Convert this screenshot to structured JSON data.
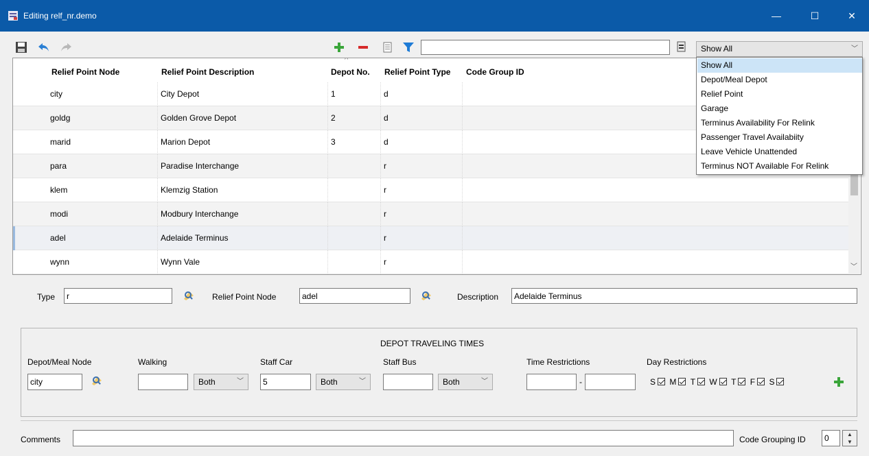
{
  "window": {
    "title": "Editing relf_nr.demo",
    "minimize": "—",
    "maximize": "☐",
    "close": "✕",
    "title_bar_color": "#0b5aa8"
  },
  "toolbar": {
    "search_value": "",
    "filter_selected": "Show All"
  },
  "filter_options": [
    "Show All",
    "Depot/Meal Depot",
    "Relief Point",
    "Garage",
    "Terminus Availability For Relink",
    "Passenger Travel Availabiity",
    "Leave Vehicle Unattended",
    "Terminus NOT Available For Relink"
  ],
  "grid": {
    "columns": [
      "Relief Point Node",
      "Relief Point Description",
      "Depot No.",
      "Relief Point Type",
      "Code Group ID"
    ],
    "rows": [
      [
        "city",
        "City Depot",
        "1",
        "d",
        ""
      ],
      [
        "goldg",
        "Golden Grove Depot",
        "2",
        "d",
        ""
      ],
      [
        "marid",
        "Marion Depot",
        "3",
        "d",
        ""
      ],
      [
        "para",
        "Paradise Interchange",
        "",
        "r",
        ""
      ],
      [
        "klem",
        "Klemzig Station",
        "",
        "r",
        ""
      ],
      [
        "modi",
        "Modbury Interchange",
        "",
        "r",
        ""
      ],
      [
        "adel",
        "Adelaide Terminus",
        "",
        "r",
        ""
      ],
      [
        "wynn",
        "Wynn Vale",
        "",
        "r",
        ""
      ]
    ]
  },
  "form": {
    "type_label": "Type",
    "type_value": "r",
    "node_label": "Relief Point Node",
    "node_value": "adel",
    "desc_label": "Description",
    "desc_value": "Adelaide Terminus"
  },
  "depot": {
    "title": "DEPOT TRAVELING TIMES",
    "meal_node_label": "Depot/Meal Node",
    "meal_node_value": "city",
    "walking_label": "Walking",
    "walking_value": "",
    "walking_mode": "Both",
    "staffcar_label": "Staff Car",
    "staffcar_value": "5",
    "staffcar_mode": "Both",
    "staffbus_label": "Staff Bus",
    "staffbus_value": "",
    "staffbus_mode": "Both",
    "time_label": "Time Restrictions",
    "time_from": "",
    "time_sep": "-",
    "time_to": "",
    "day_label": "Day Restrictions",
    "days": [
      "S",
      "M",
      "T",
      "W",
      "T",
      "F",
      "S"
    ]
  },
  "footer": {
    "comments_label": "Comments",
    "comments_value": "",
    "code_group_label": "Code Grouping ID",
    "code_group_value": "0"
  }
}
